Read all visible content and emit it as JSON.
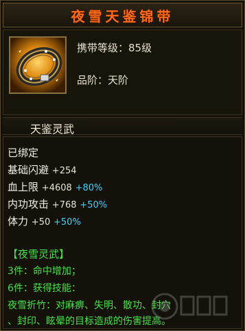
{
  "item": {
    "name": "夜雪天鉴锦带",
    "level_req": "携带等级：85级",
    "tier": "品阶：天阶",
    "set_name": "天鉴灵武",
    "bound": "已绑定"
  },
  "stats": [
    {
      "label": "基础闪避",
      "value": "+254",
      "percent": ""
    },
    {
      "label": "血上限",
      "value": "+4608",
      "percent": "+80%"
    },
    {
      "label": "内功攻击",
      "value": "+768",
      "percent": "+50%"
    },
    {
      "label": "体力",
      "value": "+50",
      "percent": "+50%"
    }
  ],
  "set_bonus": {
    "header": "【夜雪灵武】",
    "line1": "3件：命中增加；",
    "line2": "6件：获得技能：",
    "line3": "夜雪折竹：对麻痹、失明、散功、封穴",
    "line4": "、封印、眩晕的目标造成的伤害提高。"
  },
  "colors": {
    "title": "#ff6a1a",
    "set_text": "#49e049",
    "percent": "#3fd3ff"
  },
  "icons": {
    "item": "belt-icon",
    "watermark": "logo-watermark"
  }
}
